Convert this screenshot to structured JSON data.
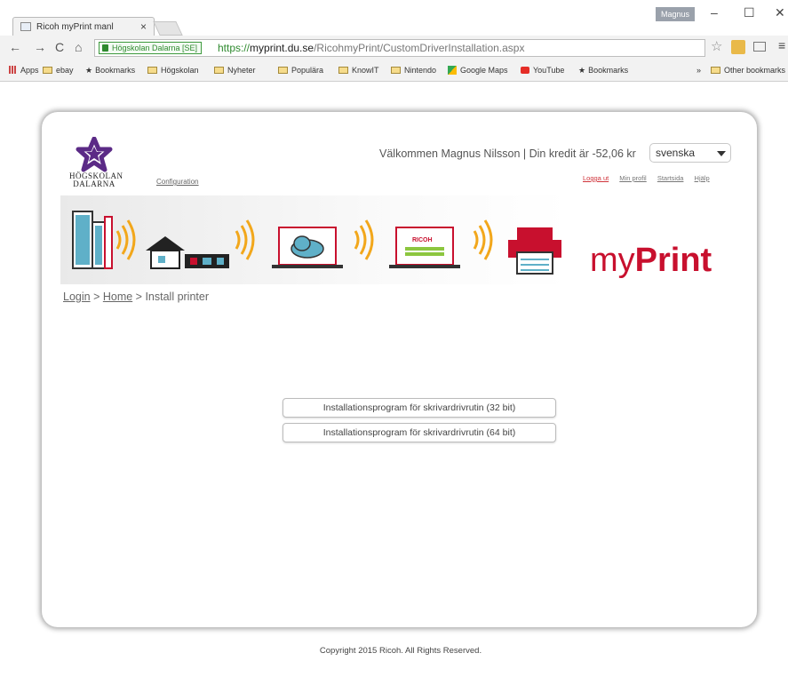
{
  "browser": {
    "tab_title": "Ricoh myPrint manl",
    "tab_close": "×",
    "profile": "Magnus",
    "minimize": "–",
    "maximize": "☐",
    "close": "✕",
    "security_label": "Högskolan Dalarna [SE]",
    "url_scheme": "https://",
    "url_host": "myprint.du.se",
    "url_path": "/RicohmyPrint/CustomDriverInstallation.aspx",
    "bookmarks": [
      {
        "label": "Apps",
        "icon": "apps-icon"
      },
      {
        "label": "ebay",
        "icon": "folder-icon"
      },
      {
        "label": "Bookmarks",
        "icon": "star-icon"
      },
      {
        "label": "Högskolan",
        "icon": "folder-icon"
      },
      {
        "label": "Nyheter",
        "icon": "folder-icon"
      },
      {
        "label": "Populära",
        "icon": "folder-icon"
      },
      {
        "label": "KnowIT",
        "icon": "folder-icon"
      },
      {
        "label": "Nintendo",
        "icon": "folder-icon"
      },
      {
        "label": "Google Maps",
        "icon": "maps-icon"
      },
      {
        "label": "YouTube",
        "icon": "youtube-icon"
      },
      {
        "label": "Bookmarks",
        "icon": "star-icon"
      }
    ],
    "more_bookmarks": "»",
    "other_bookmarks": "Other bookmarks"
  },
  "header": {
    "logo_line1": "HÖGSKOLAN",
    "logo_line2": "DALARNA",
    "configuration_link": "Configuration",
    "welcome": "Välkommen Magnus Nilsson | Din kredit är -52,06 kr",
    "language_selected": "svenska",
    "links": [
      "Logga ut",
      "Min profil",
      "Startsida",
      "Hjälp"
    ]
  },
  "banner": {
    "brand_light": "my",
    "brand_bold": "Print",
    "ricoh_screen_label": "RICOH",
    "colors": {
      "brand_red": "#c8102e",
      "logo_purple": "#5b2a86"
    }
  },
  "breadcrumb": {
    "login": "Login",
    "sep1": " > ",
    "home": "Home",
    "sep2": " > ",
    "current": "Install printer"
  },
  "main": {
    "buttons": [
      "Installationsprogram för skrivardrivrutin (32 bit)",
      "Installationsprogram för skrivardrivrutin (64 bit)"
    ]
  },
  "footer": {
    "copyright": "Copyright 2015 Ricoh. All Rights Reserved."
  }
}
